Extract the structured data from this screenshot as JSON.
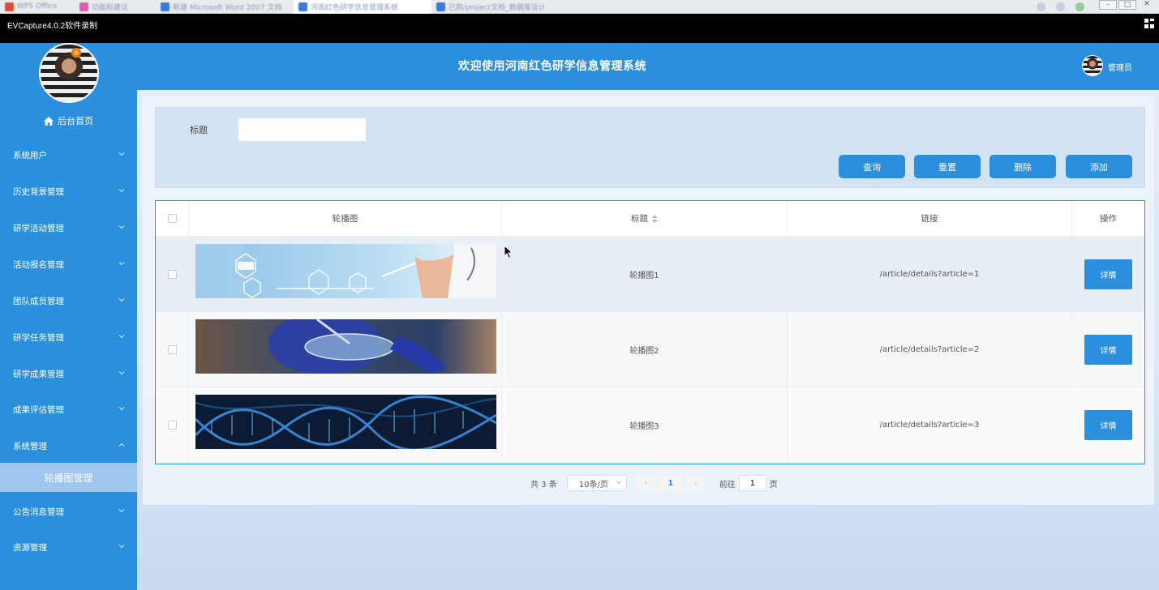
{
  "browser": {
    "tabs": [
      {
        "label": "WPS Office",
        "icon_color": "#e04a3a"
      },
      {
        "label": "功能和建议",
        "icon_color": "#d65db0"
      },
      {
        "label": "新建 Microsoft Word 2007 文档",
        "icon_color": "#3b78d8"
      },
      {
        "label": "河南红色研学信息管理系统",
        "icon_color": "#3b78d8"
      },
      {
        "label": "已购/project文档_数据库设计",
        "icon_color": "#3b78d8"
      }
    ],
    "window_controls": [
      "–",
      "□",
      "✕"
    ]
  },
  "recorder": {
    "title": "EVCapture4.0.2软件录制"
  },
  "sidebar": {
    "home_label": "后台首页",
    "items": [
      {
        "label": "系统用户",
        "expanded": false
      },
      {
        "label": "历史背景管理",
        "expanded": false
      },
      {
        "label": "研学活动管理",
        "expanded": false
      },
      {
        "label": "活动报名管理",
        "expanded": false
      },
      {
        "label": "团队成员管理",
        "expanded": false
      },
      {
        "label": "研学任务管理",
        "expanded": false
      },
      {
        "label": "研学成果管理",
        "expanded": false
      },
      {
        "label": "成果评估管理",
        "expanded": false
      },
      {
        "label": "系统管理",
        "expanded": true
      },
      {
        "label": "公告消息管理",
        "expanded": false
      },
      {
        "label": "资源管理",
        "expanded": false
      }
    ],
    "active_subitem": "轮播图管理"
  },
  "header": {
    "title": "欢迎使用河南红色研学信息管理系统",
    "user_label": "管理员"
  },
  "search": {
    "title_label": "标题",
    "title_value": "",
    "title_placeholder": "",
    "buttons": {
      "query": "查询",
      "reset": "重置",
      "delete": "删除",
      "add": "添加"
    }
  },
  "table": {
    "columns": {
      "image": "轮播图",
      "title": "标题",
      "link": "链接",
      "actions": "操作"
    },
    "rows": [
      {
        "image": "medical-tech-banner",
        "title": "轮播图1",
        "link": "/article/details?article=1",
        "action": "详情"
      },
      {
        "image": "lab-petri-dish-banner",
        "title": "轮播图2",
        "link": "/article/details?article=2",
        "action": "详情"
      },
      {
        "image": "dna-helix-banner",
        "title": "轮播图3",
        "link": "/article/details?article=3",
        "action": "详情"
      }
    ]
  },
  "pagination": {
    "total": "共 3 条",
    "page_size": "10条/页",
    "prev": "‹",
    "next": "›",
    "current_page": "1",
    "goto_label": "前往",
    "goto_value": "1",
    "goto_suffix": "页"
  },
  "colors": {
    "primary": "#2a8fdc",
    "sidebar_active": "#9fc6ec",
    "recorder_bg": "#000000"
  }
}
